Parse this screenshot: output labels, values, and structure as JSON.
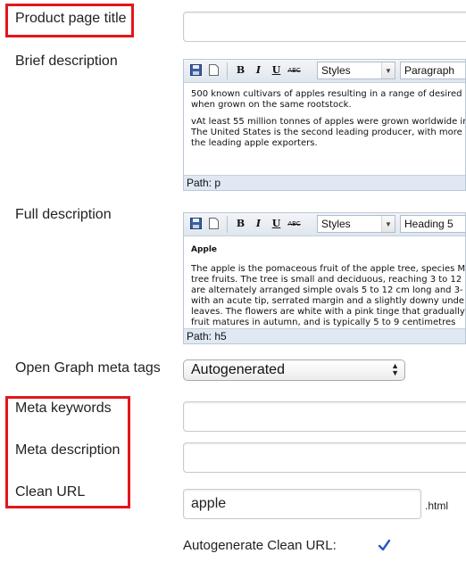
{
  "fields": {
    "product_page_title": {
      "label": "Product page title",
      "value": ""
    },
    "brief_description": {
      "label": "Brief description",
      "toolbar": {
        "styles": "Styles",
        "format": "Paragraph"
      },
      "content": [
        "500 known cultivars of apples resulting in a range of desired",
        "when grown on the same rootstock.",
        "",
        "vAt least 55 million tonnes of apples were grown worldwide in",
        "The United States is the second leading producer, with more",
        "the leading apple exporters."
      ],
      "path": "Path: p"
    },
    "full_description": {
      "label": "Full description",
      "toolbar": {
        "styles": "Styles",
        "format": "Heading 5"
      },
      "heading": "Apple",
      "content": [
        "The apple is the pomaceous fruit of the apple tree, species M",
        "tree fruits. The tree is small and deciduous, reaching 3 to 12",
        "are alternately arranged simple ovals 5 to 12 cm long and 3-",
        "with an acute tip, serrated margin and a slightly downy unde",
        "leaves. The flowers are white with a pink tinge that gradually",
        "fruit matures in autumn, and is typically 5 to 9 centimetres"
      ],
      "path": "Path: h5"
    },
    "open_graph": {
      "label": "Open Graph meta tags",
      "value": "Autogenerated"
    },
    "meta_keywords": {
      "label": "Meta keywords",
      "value": ""
    },
    "meta_description": {
      "label": "Meta description",
      "value": ""
    },
    "clean_url": {
      "label": "Clean URL",
      "value": "apple",
      "suffix": ".html"
    },
    "autogenerate_clean_url": {
      "label": "Autogenerate Clean URL:",
      "checked": true
    }
  },
  "toolbar_buttons": {
    "bold": "B",
    "italic": "I",
    "underline": "U",
    "strike": "ABC"
  },
  "highlight_color": "#e2161d"
}
